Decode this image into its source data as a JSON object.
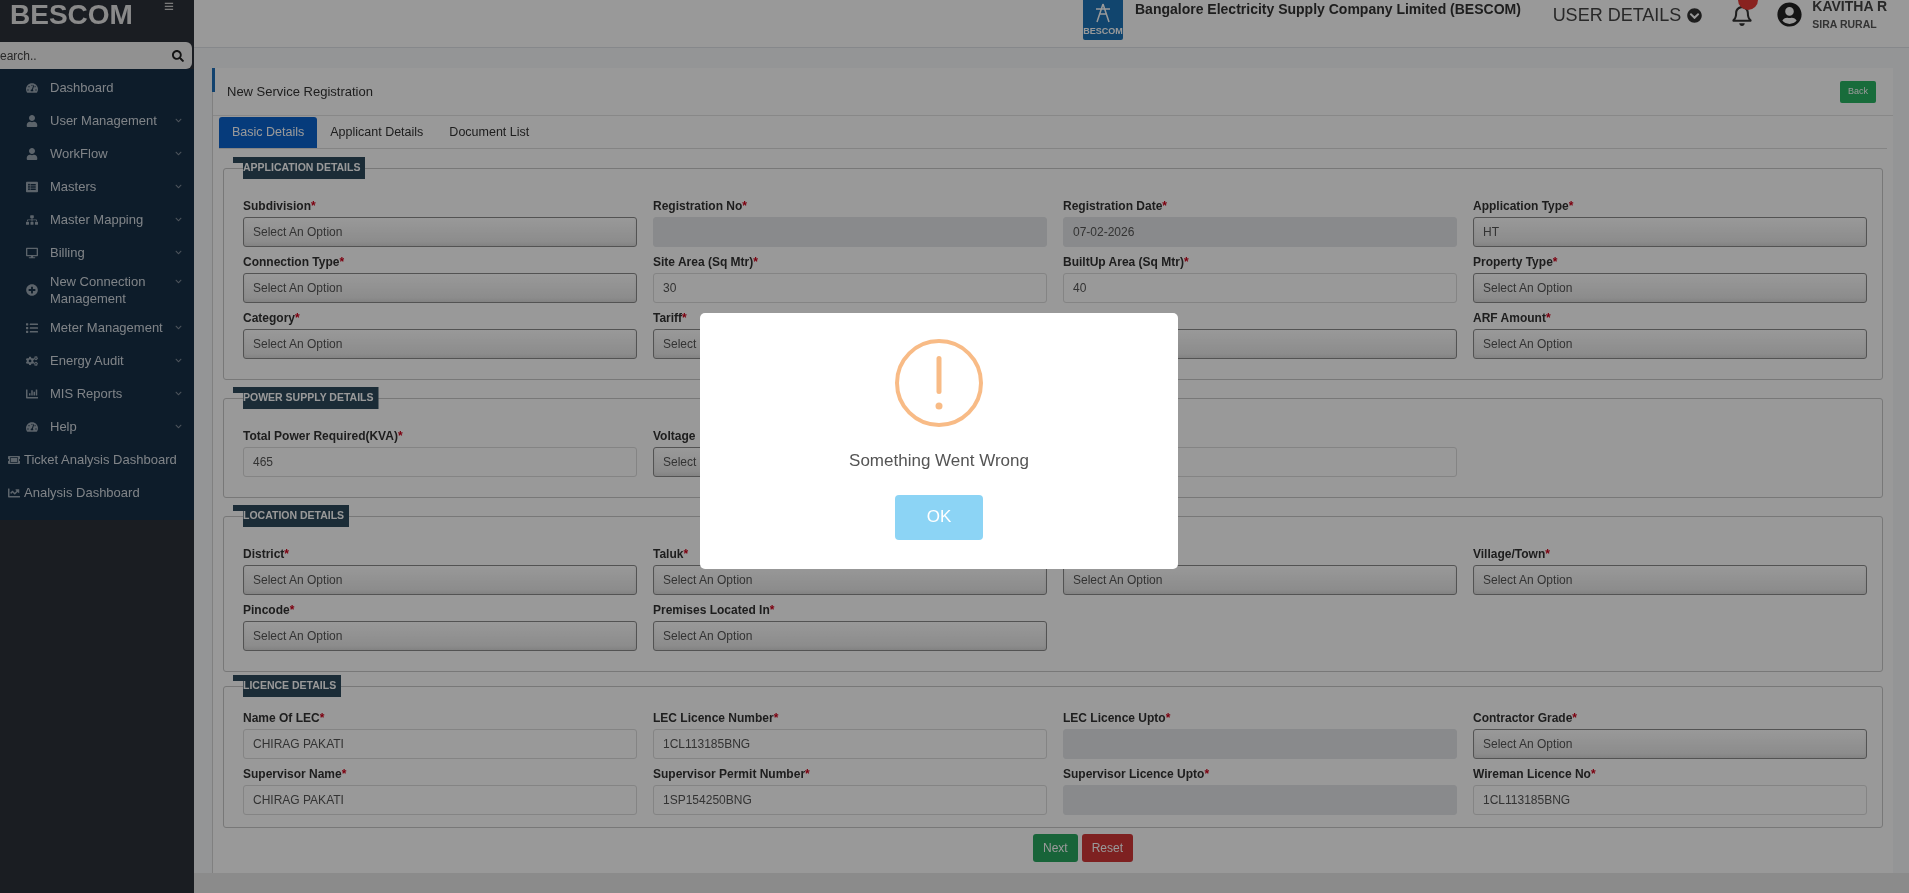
{
  "sidebar": {
    "logo": "BESCOM",
    "menu_toggle": "≡",
    "search": {
      "placeholder": "earch.."
    },
    "items": [
      {
        "label": "Dashboard",
        "kind": "link"
      },
      {
        "label": "User Management",
        "kind": "group"
      },
      {
        "label": "WorkFlow",
        "kind": "group"
      },
      {
        "label": "Masters",
        "kind": "group"
      },
      {
        "label": "Master Mapping",
        "kind": "group"
      },
      {
        "label": "Billing",
        "kind": "group"
      },
      {
        "label": "New Connection Management",
        "kind": "group"
      },
      {
        "label": "Meter Management",
        "kind": "group"
      },
      {
        "label": "Energy Audit",
        "kind": "group"
      },
      {
        "label": "MIS Reports",
        "kind": "group"
      },
      {
        "label": "Help",
        "kind": "group"
      },
      {
        "label": "Ticket Analysis Dashboard",
        "kind": "shortcut"
      },
      {
        "label": "Analysis Dashboard",
        "kind": "shortcut"
      }
    ]
  },
  "header": {
    "logo_caption": "BESCOM",
    "title": "Bangalore Electricity Supply Company Limited (BESCOM)",
    "user_details": "USER DETAILS",
    "user_name": "KAVITHA R",
    "user_location": "SIRA RURAL"
  },
  "page": {
    "title": "New Service Registration",
    "back_button": "Back",
    "tabs": [
      {
        "label": "Basic Details",
        "selected": true
      },
      {
        "label": "Applicant Details",
        "selected": false
      },
      {
        "label": "Document List",
        "selected": false
      }
    ],
    "sections": [
      {
        "title": "APPLICATION DETAILS",
        "fields": [
          {
            "label": "Subdivision",
            "mark": "*",
            "kind": "select",
            "value": "Select An Option",
            "disabled": false
          },
          {
            "label": "Registration No",
            "mark": "*",
            "kind": "input",
            "disabled": true
          },
          {
            "label": "Registration Date",
            "mark": "*",
            "kind": "input",
            "value": "07-02-2026",
            "disabled": true
          },
          {
            "label": "Application Type",
            "mark": "*",
            "kind": "select",
            "value": "HT",
            "disabled": false
          },
          {
            "label": "Connection Type",
            "mark": "*",
            "kind": "select",
            "value": "Select An Option",
            "disabled": false
          },
          {
            "label": "Site Area (Sq Mtr)",
            "mark": "*",
            "kind": "input",
            "value": "30",
            "disabled": false
          },
          {
            "label": "BuiltUp Area (Sq Mtr)",
            "mark": "*",
            "kind": "input",
            "value": "40",
            "disabled": false
          },
          {
            "label": "Property Type",
            "mark": "*",
            "kind": "select",
            "value": "Select An Option",
            "disabled": false
          },
          {
            "label": "Category",
            "mark": "*",
            "kind": "select",
            "value": "Select An Option",
            "disabled": false
          },
          {
            "label": "Tariff",
            "mark": "*",
            "kind": "select",
            "value": "Select",
            "disabled": false
          },
          {
            "kind": "select",
            "disabled": false
          },
          {
            "label": "ARF Amount",
            "mark": "*",
            "kind": "select",
            "value": "Select An Option",
            "disabled": false
          }
        ]
      },
      {
        "title": "POWER SUPPLY DETAILS",
        "fields": [
          {
            "label": "Total Power Required(KVA)",
            "mark": "*",
            "kind": "input",
            "value": "465",
            "disabled": false
          },
          {
            "label": "Voltage",
            "kind": "select",
            "value": "Select",
            "disabled": false
          },
          {
            "kind": "input",
            "disabled": false
          }
        ]
      },
      {
        "title": "LOCATION DETAILS",
        "fields": [
          {
            "label": "District",
            "mark": "*",
            "kind": "select",
            "value": "Select An Option",
            "disabled": false
          },
          {
            "label": "Taluk",
            "mark": "*",
            "kind": "select",
            "value": "Select An Option",
            "disabled": false
          },
          {
            "kind": "select",
            "value": "Select An Option",
            "disabled": false
          },
          {
            "label": "Village/Town",
            "mark": "*",
            "kind": "select",
            "value": "Select An Option",
            "disabled": false
          },
          {
            "label": "Pincode",
            "mark": "*",
            "kind": "select",
            "value": "Select An Option",
            "disabled": false
          },
          {
            "label": "Premises Located In",
            "mark": "*",
            "kind": "select",
            "value": "Select An Option",
            "disabled": false
          }
        ]
      },
      {
        "title": "LICENCE DETAILS",
        "fields": [
          {
            "label": "Name Of LEC",
            "mark": "*",
            "kind": "input",
            "value": "CHIRAG PAKATI",
            "disabled": false
          },
          {
            "label": "LEC Licence Number",
            "mark": "*",
            "kind": "input",
            "value": "1CL113185BNG",
            "disabled": false
          },
          {
            "label": "LEC Licence Upto",
            "mark": "*",
            "kind": "input",
            "disabled": true
          },
          {
            "label": "Contractor Grade",
            "mark": "*",
            "kind": "select",
            "value": "Select An Option",
            "disabled": false
          },
          {
            "label": "Supervisor Name",
            "mark": "*",
            "kind": "input",
            "value": "CHIRAG PAKATI",
            "disabled": false
          },
          {
            "label": "Supervisor Permit Number",
            "mark": "*",
            "kind": "input",
            "value": "1SP154250BNG",
            "disabled": false
          },
          {
            "label": "Supervisor Licence Upto",
            "mark": "*",
            "kind": "input",
            "disabled": true
          },
          {
            "label": "Wireman Licence No",
            "mark": "*",
            "kind": "input",
            "value": "1CL113185BNG",
            "disabled": false
          }
        ]
      }
    ],
    "buttons": [
      {
        "label": "Next",
        "kind": "primary"
      },
      {
        "label": "Reset",
        "kind": "danger"
      }
    ]
  },
  "dialog": {
    "message": "Something Went Wrong",
    "button": "OK"
  }
}
